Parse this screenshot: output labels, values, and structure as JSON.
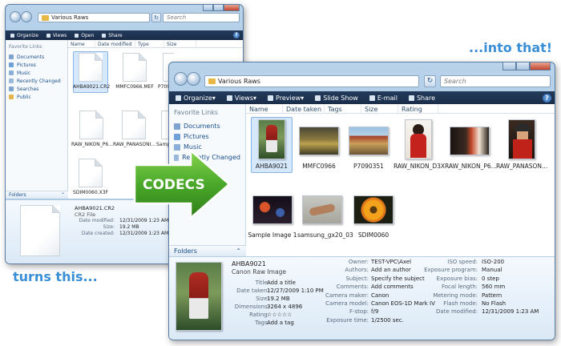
{
  "left_window": {
    "address": "Various Raws",
    "search_placeholder": "Search",
    "toolbar": {
      "organize": "Organize",
      "views": "Views",
      "open": "Open",
      "share": "Share"
    },
    "nav_header": "Favorite Links",
    "nav_items": [
      "Documents",
      "Pictures",
      "Music",
      "Recently Changed",
      "Searches",
      "Public"
    ],
    "folders_label": "Folders",
    "columns": [
      "Name",
      "Date modified",
      "Type",
      "Size"
    ],
    "files": [
      "AHBA9021.CR2",
      "MMFC0966.MEF",
      "P709",
      "RAW_NIKON_P6...",
      "RAW_PANASONI...",
      "Sample",
      "SDIM0060.X3F"
    ],
    "details": {
      "filename": "AHBA9021.CR2",
      "type": "CR2 File",
      "date_modified_key": "Date modified:",
      "date_modified": "12/31/2009 1:23 AM",
      "size_key": "Size:",
      "size": "19.2 MB",
      "date_created_key": "Date created:",
      "date_created": "12/31/2009 1:23 AM"
    }
  },
  "right_window": {
    "address": "Various Raws",
    "search_placeholder": "Search",
    "toolbar": {
      "organize": "Organize",
      "views": "Views",
      "preview": "Preview",
      "slideshow": "Slide Show",
      "email": "E-mail",
      "share": "Share"
    },
    "nav_header": "Favorite Links",
    "nav_items": [
      "Documents",
      "Pictures",
      "Music",
      "Recently Changed"
    ],
    "folders_label": "Folders",
    "columns": [
      "Name",
      "Date taken",
      "Tags",
      "Size",
      "Rating"
    ],
    "files": [
      "AHBA9021",
      "MMFC0966",
      "P7090351",
      "RAW_NIKON_D3X",
      "RAW_NIKON_P6...",
      "RAW_PANASON...",
      "Sample Image 1",
      "samsung_gx20_03",
      "SDIM0060"
    ],
    "details": {
      "name": "AHBA9021",
      "type": "Canon Raw Image",
      "fields_a": [
        {
          "k": "Title:",
          "v": "Add a title"
        },
        {
          "k": "Date taken:",
          "v": "12/27/2009 1:10 PM"
        },
        {
          "k": "Size:",
          "v": "19.2 MB"
        },
        {
          "k": "Dimensions:",
          "v": "3264 x 4896"
        },
        {
          "k": "Rating:",
          "v": "☆☆☆☆☆"
        },
        {
          "k": "Tags:",
          "v": "Add a tag"
        }
      ],
      "fields_b": [
        {
          "k": "Owner:",
          "v": "TEST-VPC\\Axel"
        },
        {
          "k": "Authors:",
          "v": "Add an author"
        },
        {
          "k": "Subject:",
          "v": "Specify the subject"
        },
        {
          "k": "Comments:",
          "v": "Add comments"
        },
        {
          "k": "Camera maker:",
          "v": "Canon"
        },
        {
          "k": "Camera model:",
          "v": "Canon EOS-1D Mark IV"
        },
        {
          "k": "F-stop:",
          "v": "f/9"
        },
        {
          "k": "Exposure time:",
          "v": "1/2500 sec."
        }
      ],
      "fields_c": [
        {
          "k": "ISO speed:",
          "v": "ISO-200"
        },
        {
          "k": "Exposure program:",
          "v": "Manual"
        },
        {
          "k": "Exposure bias:",
          "v": "0 step"
        },
        {
          "k": "Focal length:",
          "v": "560 mm"
        },
        {
          "k": "Metering mode:",
          "v": "Pattern"
        },
        {
          "k": "Flash mode:",
          "v": "No Flash"
        },
        {
          "k": "Date modified:",
          "v": "12/31/2009 1:23 AM"
        }
      ]
    }
  },
  "callouts": {
    "into": "...into that!",
    "turns": "turns this...",
    "arrow_label": "CODECS"
  },
  "colors": {
    "accent": "#3b8fd6",
    "arrow_green": "#55b32a",
    "toolbar": "#1f3553"
  }
}
